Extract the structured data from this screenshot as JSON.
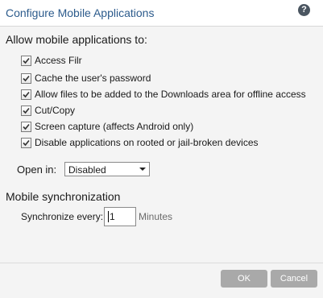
{
  "dialog": {
    "title": "Configure Mobile Applications",
    "help_icon": "?"
  },
  "allow_section": {
    "heading": "Allow mobile applications to:",
    "options": [
      {
        "label": "Access Filr",
        "checked": true
      },
      {
        "label": "Cache the user's password",
        "checked": true
      },
      {
        "label": "Allow files to be added to the Downloads area for offline access",
        "checked": true
      },
      {
        "label": "Cut/Copy",
        "checked": true
      },
      {
        "label": "Screen capture (affects Android only)",
        "checked": true
      },
      {
        "label": "Disable applications on rooted or jail-broken devices",
        "checked": true
      }
    ]
  },
  "open_in": {
    "label": "Open in:",
    "selected": "Disabled"
  },
  "sync_section": {
    "heading": "Mobile synchronization",
    "label": "Synchronize every:",
    "value": "1",
    "unit": "Minutes"
  },
  "footer": {
    "ok_label": "OK",
    "cancel_label": "Cancel"
  },
  "colors": {
    "title": "#2c5b8c",
    "button": "#a9a9a9",
    "background": "#f4f4f4"
  }
}
